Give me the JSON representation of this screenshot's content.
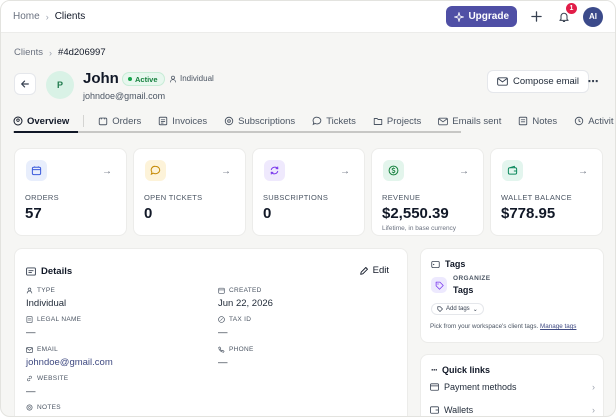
{
  "topbar": {
    "breadcrumb": [
      "Home",
      "Clients"
    ],
    "upgrade_label": "Upgrade",
    "notification_count": "1",
    "avatar_initials": "AI"
  },
  "subcrumb": [
    "Clients",
    "#4d206997"
  ],
  "client": {
    "avatar_initial": "P",
    "name": "John",
    "status": "Active",
    "type": "Individual",
    "email": "johndoe@gmail.com"
  },
  "actions": {
    "compose_label": "Compose email",
    "more_label": "⋯"
  },
  "tabs": [
    {
      "label": "Overview",
      "icon": "overview-icon",
      "active": true
    },
    {
      "label": "Orders",
      "icon": "orders-icon"
    },
    {
      "label": "Invoices",
      "icon": "invoices-icon"
    },
    {
      "label": "Subscriptions",
      "icon": "subscriptions-icon"
    },
    {
      "label": "Tickets",
      "icon": "tickets-icon"
    },
    {
      "label": "Projects",
      "icon": "projects-icon"
    },
    {
      "label": "Emails sent",
      "icon": "emails-icon"
    },
    {
      "label": "Notes",
      "icon": "notes-icon"
    },
    {
      "label": "Activit",
      "icon": "activity-icon"
    }
  ],
  "stats": [
    {
      "label": "ORDERS",
      "value": "57",
      "sub": "",
      "icon": "orders-icon",
      "color": "#e8eefc",
      "stroke": "#3b5bdb"
    },
    {
      "label": "OPEN TICKETS",
      "value": "0",
      "sub": "",
      "icon": "tickets-icon",
      "color": "#fdf3d9",
      "stroke": "#c58a06"
    },
    {
      "label": "SUBSCRIPTIONS",
      "value": "0",
      "sub": "",
      "icon": "subscriptions-icon",
      "color": "#efe9fd",
      "stroke": "#7c3aed"
    },
    {
      "label": "REVENUE",
      "value": "$2,550.39",
      "sub": "Lifetime, in base currency",
      "icon": "revenue-icon",
      "color": "#e3f5ec",
      "stroke": "#15803d"
    },
    {
      "label": "WALLET BALANCE",
      "value": "$778.95",
      "sub": "",
      "icon": "wallet-icon",
      "color": "#e3f5ee",
      "stroke": "#0f8a5f"
    }
  ],
  "details": {
    "title": "Details",
    "edit_label": "Edit",
    "fields": {
      "type": {
        "label": "TYPE",
        "value": "Individual"
      },
      "created": {
        "label": "CREATED",
        "value": "Jun 22, 2026"
      },
      "legal_name": {
        "label": "LEGAL NAME",
        "value": "—"
      },
      "tax_id": {
        "label": "TAX ID",
        "value": "—"
      },
      "email": {
        "label": "EMAIL",
        "value": "johndoe@gmail.com"
      },
      "phone": {
        "label": "PHONE",
        "value": "—"
      },
      "website": {
        "label": "WEBSITE",
        "value": "—"
      },
      "notes": {
        "label": "NOTES",
        "value": ""
      }
    }
  },
  "tags": {
    "title": "Tags",
    "org_label": "ORGANIZE",
    "org_name": "Tags",
    "add_label": "Add tags",
    "help_text": "Pick from your workspace's client tags.",
    "manage_link": "Manage tags"
  },
  "quick_links": {
    "title": "Quick links",
    "items": [
      "Payment methods",
      "Wallets"
    ]
  }
}
